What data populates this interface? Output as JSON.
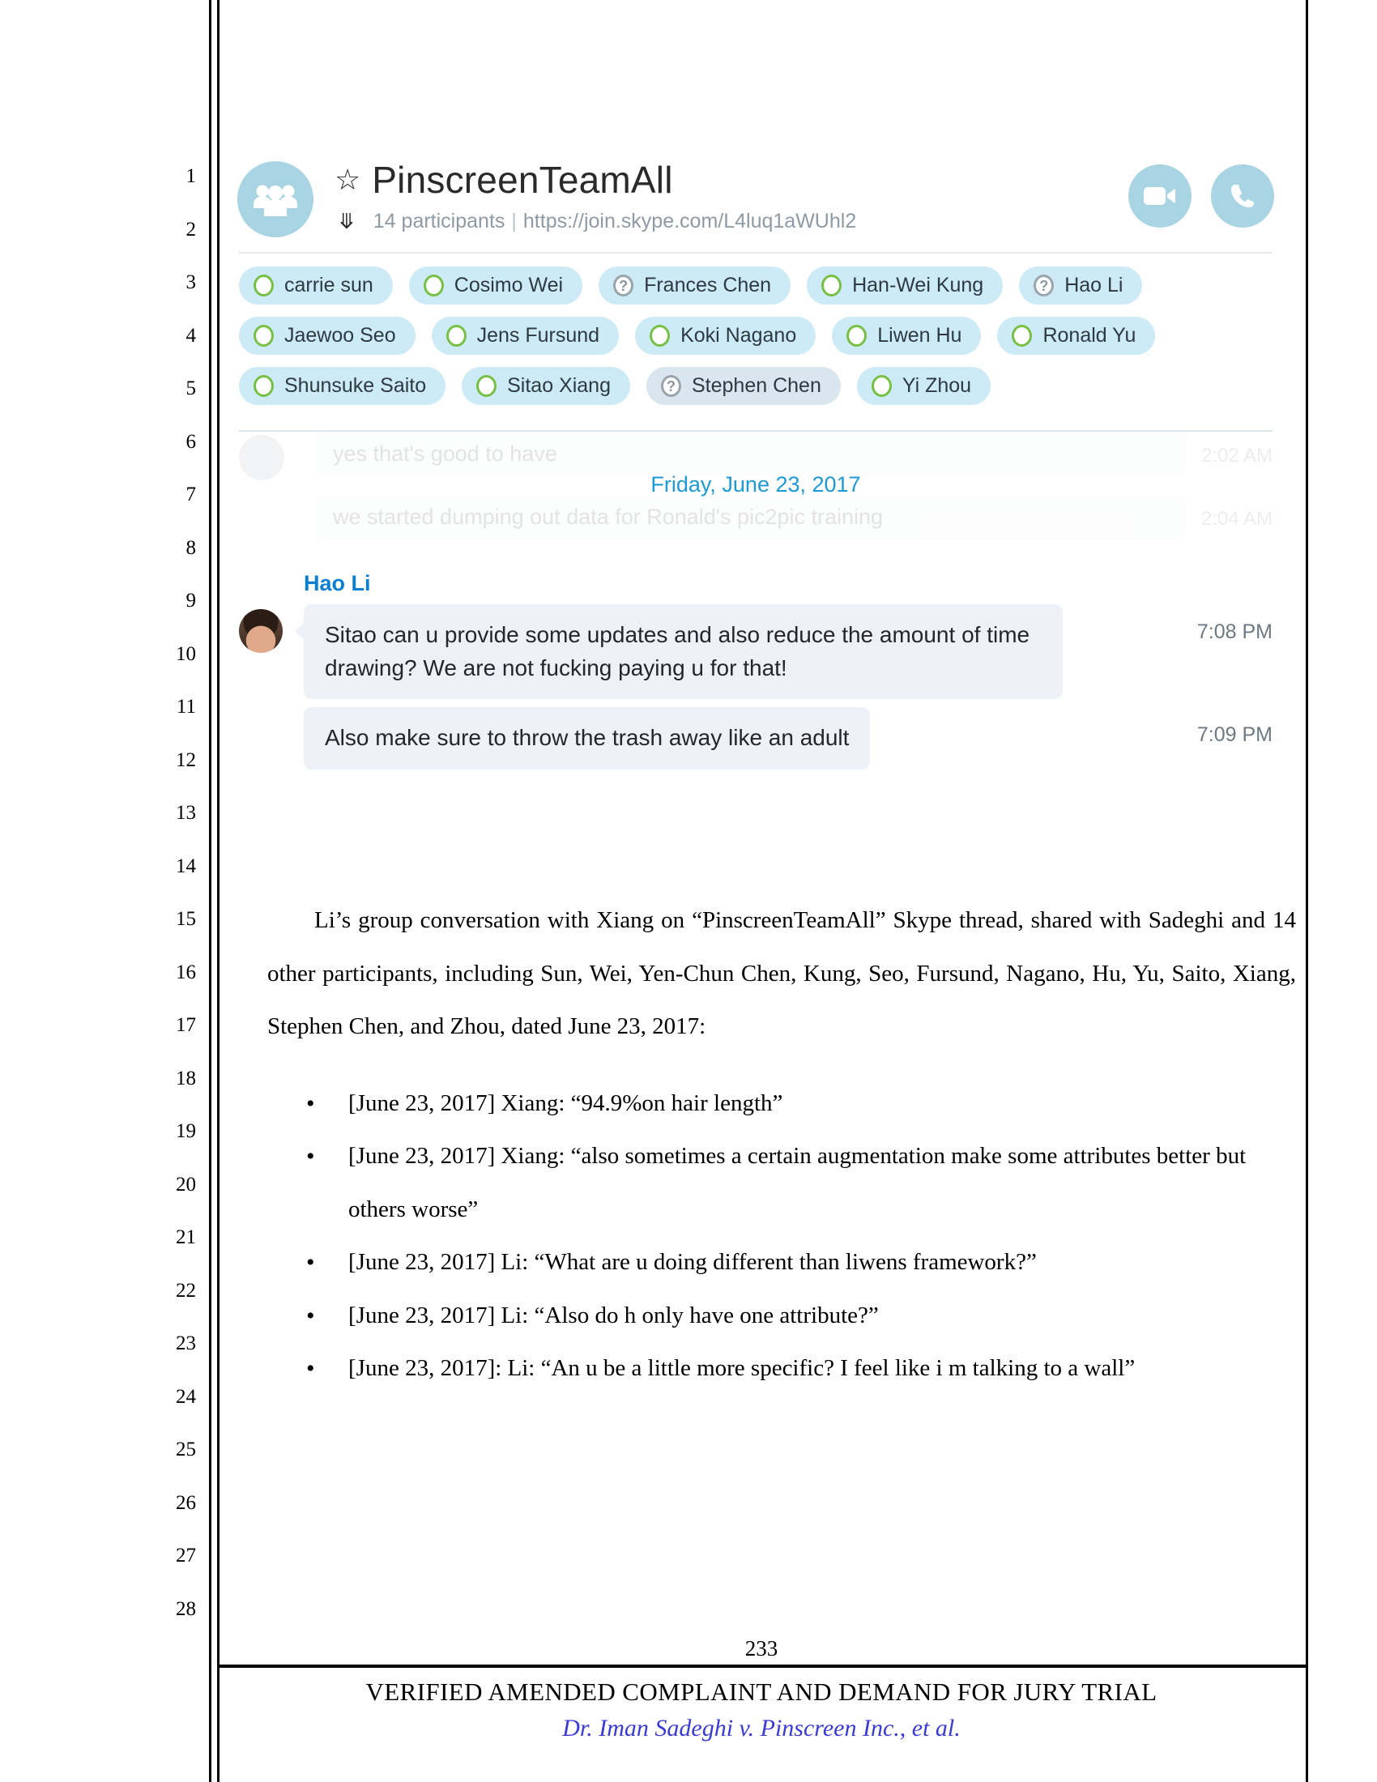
{
  "document": {
    "line_numbers": [
      "1",
      "2",
      "3",
      "4",
      "5",
      "6",
      "7",
      "8",
      "9",
      "10",
      "11",
      "12",
      "13",
      "14",
      "15",
      "16",
      "17",
      "18",
      "19",
      "20",
      "21",
      "22",
      "23",
      "24",
      "25",
      "26",
      "27",
      "28"
    ],
    "page_number": "233",
    "footer_title": "VERIFIED AMENDED COMPLAINT AND DEMAND FOR JURY TRIAL",
    "footer_case": "Dr. Iman Sadeghi v. Pinscreen Inc., et al."
  },
  "skype": {
    "chat_title": "PinscreenTeamAll",
    "star_icon": "star-icon",
    "chevron_icon": "chevron-down-icon",
    "participants_count_label": "14 participants",
    "separator": "|",
    "join_url": "https://join.skype.com/L4luq1aWUhl2",
    "video_call_icon": "video-camera-icon",
    "voice_call_icon": "phone-icon",
    "group_avatar_icon": "group-people-icon",
    "accent_color": "#a8d4e4",
    "chip_color": "#cdeaf7",
    "presence_online_color": "#76c043",
    "presence_unknown_color": "#9aa5ab",
    "participant_rows": [
      [
        {
          "name": "carrie sun",
          "presence": "online"
        },
        {
          "name": "Cosimo Wei",
          "presence": "online"
        },
        {
          "name": "Frances Chen",
          "presence": "unknown"
        },
        {
          "name": "Han-Wei Kung",
          "presence": "online"
        },
        {
          "name": "Hao Li",
          "presence": "unknown"
        }
      ],
      [
        {
          "name": "Jaewoo Seo",
          "presence": "online"
        },
        {
          "name": "Jens Fursund",
          "presence": "online"
        },
        {
          "name": "Koki Nagano",
          "presence": "online"
        },
        {
          "name": "Liwen Hu",
          "presence": "online"
        },
        {
          "name": "Ronald Yu",
          "presence": "online"
        }
      ],
      [
        {
          "name": "Shunsuke Saito",
          "presence": "online"
        },
        {
          "name": "Sitao Xiang",
          "presence": "online"
        },
        {
          "name": "Stephen Chen",
          "presence": "unknown"
        },
        {
          "name": "Yi Zhou",
          "presence": "online"
        }
      ]
    ],
    "faded_messages": [
      {
        "text": "yes that's good to have",
        "time": "2:02 AM"
      },
      {
        "text": "we started dumping out data for Ronald's pic2pic training",
        "time": "2:04 AM"
      }
    ],
    "date_stamp": "Friday, June 23, 2017",
    "sender": "Hao Li",
    "messages": [
      {
        "text": "Sitao can u provide some updates and also reduce the amount of time drawing? We are not fucking paying u for that!",
        "time": "7:08 PM"
      },
      {
        "text": "Also make sure to throw the trash away like an adult",
        "time": "7:09 PM"
      }
    ]
  },
  "body": {
    "paragraph": "Li’s group conversation with Xiang on “PinscreenTeamAll” Skype thread, shared with Sadeghi and 14 other participants, including Sun, Wei, Yen-Chun Chen, Kung, Seo, Fursund, Nagano, Hu, Yu, Saito, Xiang, Stephen Chen, and Zhou, dated June 23, 2017:",
    "bullets": [
      "[June 23, 2017] Xiang: “94.9%on hair length”",
      "[June 23, 2017] Xiang: “also sometimes a certain augmentation make some attributes better but others worse”",
      "[June 23, 2017] Li: “What are u doing different than liwens framework?”",
      "[June 23, 2017] Li: “Also do h only have one attribute?”",
      "[June 23, 2017]: Li: “An u be a little more specific? I feel like i m talking to a wall”"
    ]
  }
}
